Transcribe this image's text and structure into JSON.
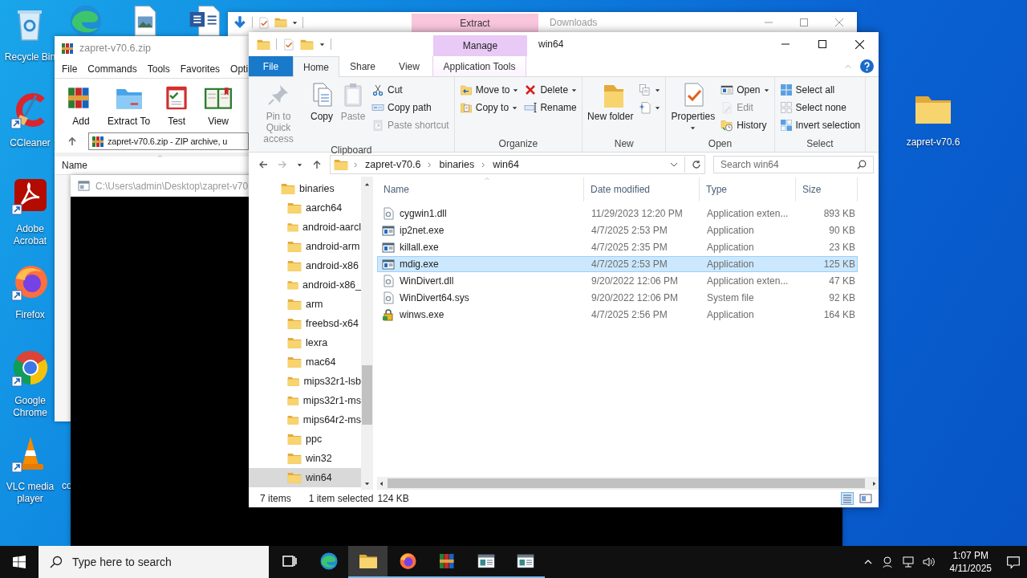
{
  "desktop": {
    "icons": [
      {
        "kind": "recycle",
        "label": "Recycle Bin"
      },
      {
        "kind": "ccleaner",
        "label": "CCleaner"
      },
      {
        "kind": "acrobat",
        "label": "Adobe Acrobat"
      },
      {
        "kind": "firefox",
        "label": "Firefox"
      },
      {
        "kind": "chrome",
        "label": "Google Chrome"
      },
      {
        "kind": "vlc",
        "label": "VLC media player"
      }
    ],
    "top_icons": [
      {
        "kind": "edge"
      },
      {
        "kind": "image"
      },
      {
        "kind": "word"
      }
    ],
    "partial_label": "co",
    "right_icons": [
      {
        "kind": "folder",
        "label": "zapret-v70.6"
      }
    ]
  },
  "winrar": {
    "title": "zapret-v70.6.zip",
    "menu": [
      "File",
      "Commands",
      "Tools",
      "Favorites",
      "Opti"
    ],
    "toolbar": [
      {
        "kind": "add",
        "label": "Add"
      },
      {
        "kind": "extract",
        "label": "Extract To"
      },
      {
        "kind": "test",
        "label": "Test"
      },
      {
        "kind": "view",
        "label": "View"
      }
    ],
    "address": "zapret-v70.6.zip - ZIP archive, u",
    "column": "Name"
  },
  "console": {
    "title": "C:\\Users\\admin\\Desktop\\zapret-v70"
  },
  "downloads": {
    "title": "Downloads",
    "context_tab": "Extract"
  },
  "explorer": {
    "title": "win64",
    "context_tab": "Manage",
    "tabs": [
      {
        "kind": "file",
        "label": "File",
        "selected": false
      },
      {
        "kind": "normal",
        "label": "Home",
        "selected": true
      },
      {
        "kind": "normal",
        "label": "Share",
        "selected": false
      },
      {
        "kind": "normal",
        "label": "View",
        "selected": false
      },
      {
        "kind": "context",
        "label": "Application Tools",
        "selected": false
      }
    ],
    "ribbon": [
      {
        "name": "Clipboard",
        "columns": [
          {
            "kind": "large",
            "items": [
              {
                "kind": "pin",
                "label": "Pin to Quick access",
                "disabled": true,
                "dropdown": false
              }
            ]
          },
          {
            "kind": "large",
            "items": [
              {
                "kind": "copy",
                "label": "Copy",
                "disabled": false,
                "dropdown": false
              }
            ]
          },
          {
            "kind": "large",
            "items": [
              {
                "kind": "paste",
                "label": "Paste",
                "disabled": true,
                "dropdown": false
              }
            ]
          },
          {
            "kind": "small",
            "items": [
              {
                "kind": "cut",
                "label": "Cut",
                "disabled": false,
                "dropdown": false
              },
              {
                "kind": "copypath",
                "label": "Copy path",
                "disabled": false,
                "dropdown": false
              },
              {
                "kind": "pasteshortcut",
                "label": "Paste shortcut",
                "disabled": true,
                "dropdown": false
              }
            ]
          }
        ]
      },
      {
        "name": "Organize",
        "columns": [
          {
            "kind": "small",
            "items": [
              {
                "kind": "moveto",
                "label": "Move to",
                "disabled": false,
                "dropdown": true
              },
              {
                "kind": "copyto",
                "label": "Copy to",
                "disabled": false,
                "dropdown": true
              }
            ]
          },
          {
            "kind": "small",
            "items": [
              {
                "kind": "delete",
                "label": "Delete",
                "disabled": false,
                "dropdown": true
              },
              {
                "kind": "rename",
                "label": "Rename",
                "disabled": false,
                "dropdown": false
              }
            ]
          }
        ]
      },
      {
        "name": "New",
        "columns": [
          {
            "kind": "large",
            "items": [
              {
                "kind": "newfolder",
                "label": "New folder",
                "disabled": false,
                "dropdown": false
              }
            ]
          },
          {
            "kind": "small",
            "items": [
              {
                "kind": "newitem",
                "disabled": false,
                "dropdown": true
              },
              {
                "kind": "easyaccess",
                "disabled": false,
                "dropdown": true
              }
            ]
          }
        ]
      },
      {
        "name": "Open",
        "columns": [
          {
            "kind": "large",
            "items": [
              {
                "kind": "properties",
                "label": "Properties",
                "disabled": false,
                "dropdown": true
              }
            ]
          },
          {
            "kind": "small",
            "items": [
              {
                "kind": "open",
                "label": "Open",
                "disabled": false,
                "dropdown": true
              },
              {
                "kind": "edit",
                "label": "Edit",
                "disabled": true,
                "dropdown": false
              },
              {
                "kind": "history",
                "label": "History",
                "disabled": false,
                "dropdown": false
              }
            ]
          }
        ]
      },
      {
        "name": "Select",
        "columns": [
          {
            "kind": "small",
            "items": [
              {
                "kind": "selectall",
                "label": "Select all",
                "disabled": false,
                "dropdown": false
              },
              {
                "kind": "selectnone",
                "label": "Select none",
                "disabled": false,
                "dropdown": false
              },
              {
                "kind": "invert",
                "label": "Invert selection",
                "disabled": false,
                "dropdown": false
              }
            ]
          }
        ]
      }
    ],
    "breadcrumbs": [
      "zapret-v70.6",
      "binaries",
      "win64"
    ],
    "search_placeholder": "Search win64",
    "nav": [
      {
        "label": "binaries",
        "selected": false,
        "children": [
          {
            "label": "aarch64",
            "selected": false
          },
          {
            "label": "android-aarcl",
            "selected": false
          },
          {
            "label": "android-arm",
            "selected": false
          },
          {
            "label": "android-x86",
            "selected": false
          },
          {
            "label": "android-x86_",
            "selected": false
          },
          {
            "label": "arm",
            "selected": false
          },
          {
            "label": "freebsd-x64",
            "selected": false
          },
          {
            "label": "lexra",
            "selected": false
          },
          {
            "label": "mac64",
            "selected": false
          },
          {
            "label": "mips32r1-lsb",
            "selected": false
          },
          {
            "label": "mips32r1-ms",
            "selected": false
          },
          {
            "label": "mips64r2-ms",
            "selected": false
          },
          {
            "label": "ppc",
            "selected": false
          },
          {
            "label": "win32",
            "selected": false
          },
          {
            "label": "win64",
            "selected": true
          }
        ]
      }
    ],
    "columns": [
      "Name",
      "Date modified",
      "Type",
      "Size"
    ],
    "rows": [
      {
        "kind": "dll",
        "name": "cygwin1.dll",
        "date": "11/29/2023 12:20 PM",
        "type": "Application exten...",
        "size": "893 KB",
        "selected": false
      },
      {
        "kind": "exe",
        "name": "ip2net.exe",
        "date": "4/7/2025 2:53 PM",
        "type": "Application",
        "size": "90 KB",
        "selected": false
      },
      {
        "kind": "exe",
        "name": "killall.exe",
        "date": "4/7/2025 2:35 PM",
        "type": "Application",
        "size": "23 KB",
        "selected": false
      },
      {
        "kind": "exe",
        "name": "mdig.exe",
        "date": "4/7/2025 2:53 PM",
        "type": "Application",
        "size": "125 KB",
        "selected": true
      },
      {
        "kind": "dll",
        "name": "WinDivert.dll",
        "date": "9/20/2022 12:06 PM",
        "type": "Application exten...",
        "size": "47 KB",
        "selected": false
      },
      {
        "kind": "dll",
        "name": "WinDivert64.sys",
        "date": "9/20/2022 12:06 PM",
        "type": "System file",
        "size": "92 KB",
        "selected": false
      },
      {
        "kind": "secure",
        "name": "winws.exe",
        "date": "4/7/2025 2:56 PM",
        "type": "Application",
        "size": "164 KB",
        "selected": false
      }
    ],
    "status": [
      "7 items",
      "1 item selected",
      "124 KB"
    ]
  },
  "taskbar": {
    "search_placeholder": "Type here to search",
    "apps": [
      {
        "kind": "taskview",
        "active": false,
        "running": false
      },
      {
        "kind": "edge",
        "active": false,
        "running": false
      },
      {
        "kind": "explorer",
        "active": true,
        "running": true
      },
      {
        "kind": "firefox",
        "active": false,
        "running": true
      },
      {
        "kind": "winrar",
        "active": false,
        "running": true
      },
      {
        "kind": "console",
        "active": false,
        "running": true
      },
      {
        "kind": "console",
        "active": false,
        "running": true
      }
    ],
    "time": "1:07 PM",
    "date": "4/11/2025"
  }
}
